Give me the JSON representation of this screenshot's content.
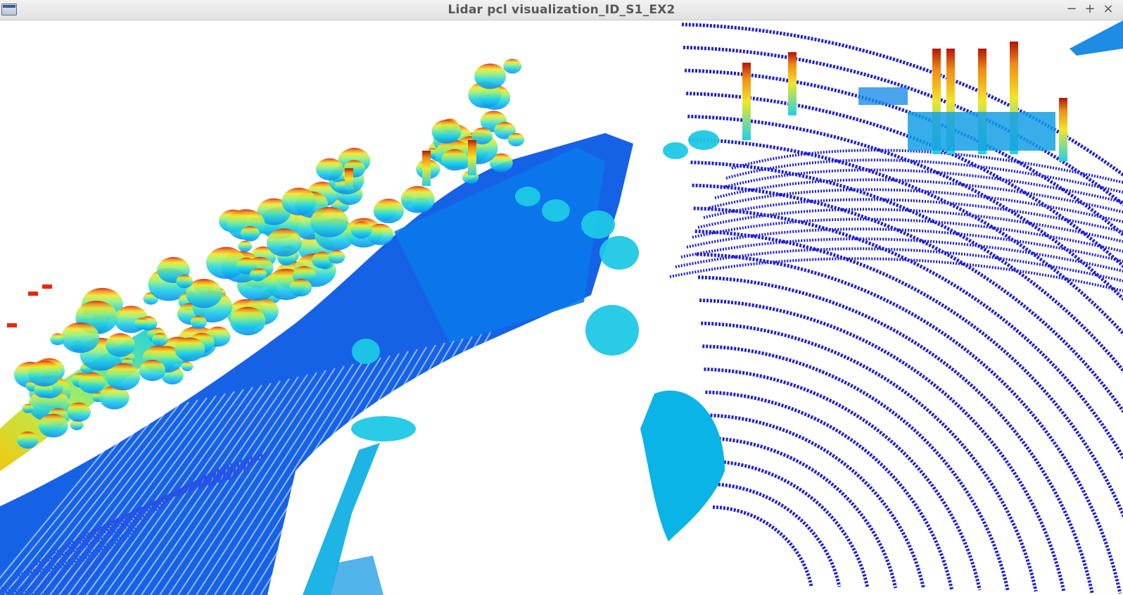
{
  "window": {
    "title": "Lidar pcl visualization_ID_S1_EX2",
    "icon": "app-window-icon",
    "controls": {
      "minimize": "−",
      "maximize": "+",
      "close": "×"
    }
  },
  "viewer": {
    "background": "#ffffff",
    "colormap": [
      "#0000c8",
      "#0050e6",
      "#0a8cf0",
      "#1ed2e6",
      "#96f078",
      "#f0e628",
      "#f08c14",
      "#d21e0a",
      "#8c0000"
    ]
  }
}
